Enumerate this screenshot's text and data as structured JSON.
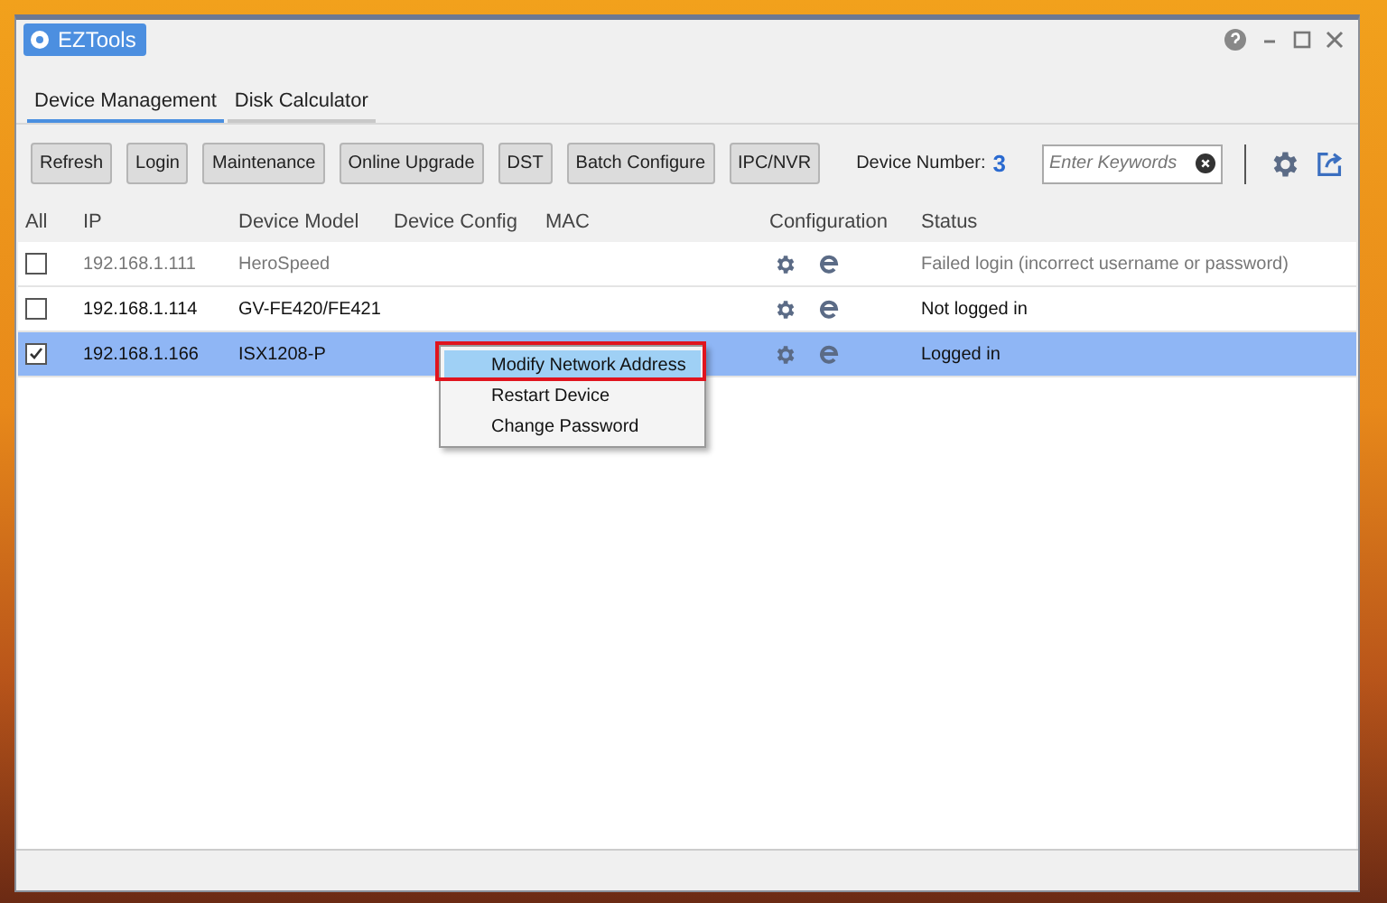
{
  "window": {
    "title": "EZTools"
  },
  "tabs": [
    {
      "label": "Device Management",
      "selected": true
    },
    {
      "label": "Disk Calculator",
      "selected": false
    }
  ],
  "toolbar": {
    "buttons": [
      "Refresh",
      "Login",
      "Maintenance",
      "Online Upgrade",
      "DST",
      "Batch Configure",
      "IPC/NVR"
    ],
    "device_number_label": "Device Number:",
    "device_number": "3",
    "search": {
      "placeholder": "Enter Keywords"
    }
  },
  "table": {
    "columns": [
      "All",
      "IP",
      "Device Model",
      "Device Config",
      "MAC",
      "Configuration",
      "Status"
    ],
    "rows": [
      {
        "checked": false,
        "selected": false,
        "dimmed": true,
        "ip": "192.168.1.111",
        "model": "HeroSpeed",
        "status": "Failed login (incorrect username or password)"
      },
      {
        "checked": false,
        "selected": false,
        "dimmed": false,
        "ip": "192.168.1.114",
        "model": "GV-FE420/FE421",
        "status": "Not logged in"
      },
      {
        "checked": true,
        "selected": true,
        "dimmed": false,
        "ip": "192.168.1.166",
        "model": "ISX1208-P",
        "status": "Logged in"
      }
    ]
  },
  "context_menu": {
    "items": [
      {
        "label": "Modify Network Address",
        "selected": true
      },
      {
        "label": "Restart Device",
        "selected": false
      },
      {
        "label": "Change Password",
        "selected": false
      }
    ]
  }
}
